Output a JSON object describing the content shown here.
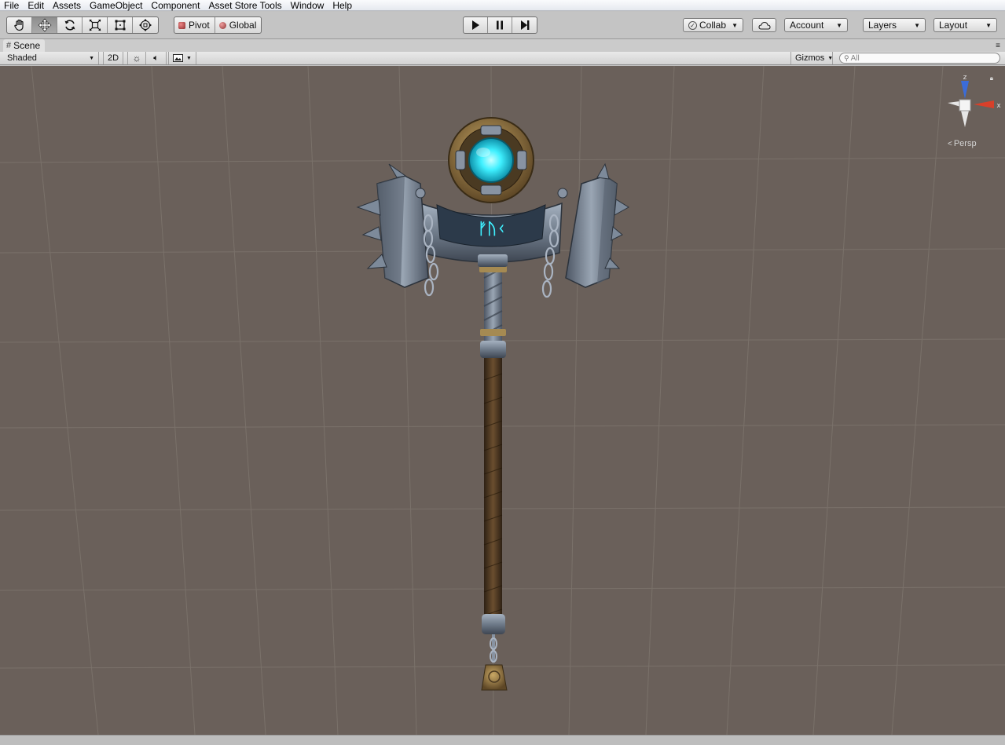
{
  "menu": [
    "File",
    "Edit",
    "Assets",
    "GameObject",
    "Component",
    "Asset Store Tools",
    "Window",
    "Help"
  ],
  "toolbar": {
    "tools": [
      "hand-tool-icon",
      "move-tool-icon",
      "rotate-tool-icon",
      "scale-tool-icon",
      "rect-tool-icon",
      "transform-tool-icon"
    ],
    "pivot_label": "Pivot",
    "global_label": "Global",
    "collab_label": "Collab",
    "account_label": "Account",
    "layers_label": "Layers",
    "layout_label": "Layout"
  },
  "scene_tab": {
    "label": "Scene"
  },
  "scene_bar": {
    "shading_mode": "Shaded",
    "mode_2d": "2D",
    "gizmos_label": "Gizmos",
    "search_placeholder": "All"
  },
  "viewport": {
    "projection_label": "Persp",
    "axis_labels": {
      "y": "z",
      "x": "x"
    },
    "rune_text": "ᚠᚢᚲ",
    "colors": {
      "background": "#6a605a",
      "grid": "#7a716a",
      "glow": "#3ff0ff",
      "metal": "#7d8a9a",
      "bronze": "#9a7a45",
      "wood": "#4a3622"
    }
  }
}
